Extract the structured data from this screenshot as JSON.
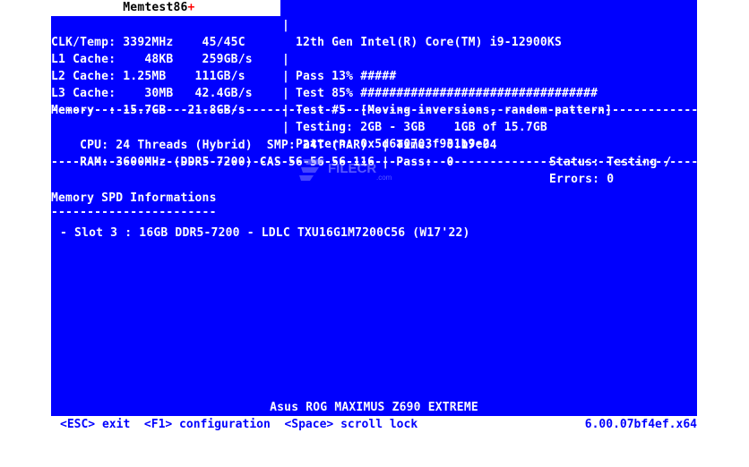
{
  "header": {
    "logo_text": "Memtest86",
    "logo_plus": "+",
    "cpu_name": "12th Gen Intel(R) Core(TM) i9-12900KS",
    "clk_temp": "CLK/Temp: 3392MHz    45/45C",
    "pass_progress": "Pass 13% #####",
    "l1_cache": "L1 Cache:    48KB    259GB/s",
    "test_progress": "Test 85% #################################",
    "l2_cache": "L2 Cache: 1.25MB    111GB/s",
    "test_name": "Test #5  [Moving inversions, random pattern]",
    "l3_cache": "L3 Cache:    30MB   42.4GB/s",
    "testing_range": "Testing: 2GB - 3GB    1GB of 15.7GB",
    "memory": "Memory  : 15.7GB   21.8GB/s",
    "pattern": "Pattern: 0x5d6a0703f931b9e2",
    "separator": "|"
  },
  "status": {
    "cpu_line": "CPU: 24 Threads (Hybrid)  SMP: 24T (PAR)  | Time:  0:17:04",
    "status_label": "Status: Testing /",
    "ram_line": "RAM: 3600MHz (DDR5-7200) CAS 56-56-56-116 | Pass:  0",
    "errors_label": "Errors: 0"
  },
  "spd": {
    "title": "Memory SPD Informations",
    "underline": "-----------------------",
    "slots": [
      "- Slot 3 : 16GB DDR5-7200 - LDLC TXU16G1M7200C56 (W17'22)"
    ]
  },
  "dashes": "------------------------------------------------------------------------------------------------------",
  "footer": {
    "board": "Asus ROG MAXIMUS Z690 EXTREME",
    "keys": "<ESC> exit  <F1> configuration  <Space> scroll lock",
    "version": "6.00.07bf4ef.x64"
  },
  "watermark": {
    "text": "FILECR",
    "sub": ".com"
  },
  "colors": {
    "background": "#0000fe",
    "text": "#ffffff",
    "logo_plus": "#ff0000"
  }
}
